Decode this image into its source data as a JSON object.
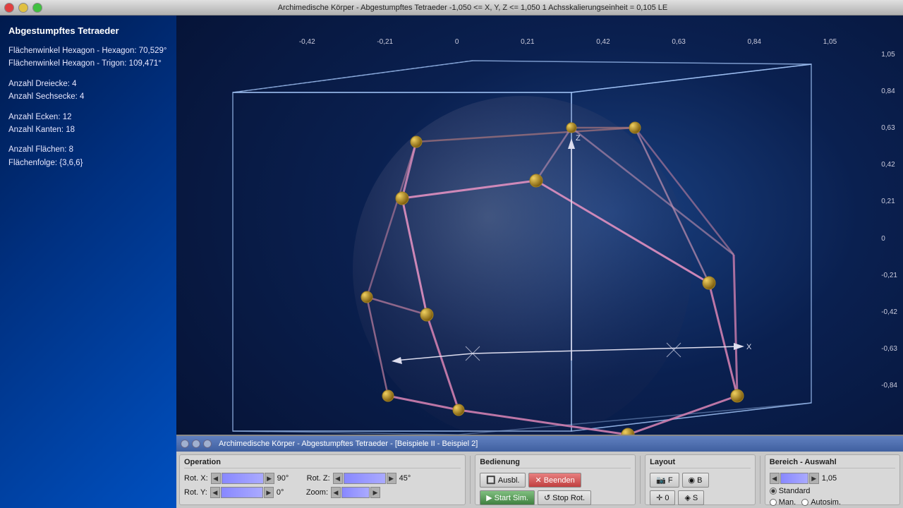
{
  "titlebar": {
    "text": "Archimedische Körper - Abgestumpftes Tetraeder  -1,050 <= X, Y, Z <= 1,050  1 Achsskalierungseinheit = 0,105 LE"
  },
  "info": {
    "title": "Abgestumpftes Tetraeder",
    "flaechen_winkel_1_label": "Flächenwinkel Hexagon - Hexagon: 70,529°",
    "flaechen_winkel_2_label": "Flächenwinkel Hexagon - Trigon: 109,471°",
    "anzahl_dreiecke_label": "Anzahl Dreiecke: 4",
    "anzahl_sechsecke_label": "Anzahl Sechsecke: 4",
    "anzahl_ecken_label": "Anzahl Ecken: 12",
    "anzahl_kanten_label": "Anzahl Kanten: 18",
    "anzahl_flaechen_label": "Anzahl Flächen: 8",
    "flaechenfolge_label": "Flächenfolge: {3,6,6}"
  },
  "subtitlebar": {
    "text": "Archimedische Körper - Abgestumpftes Tetraeder - [Beispiele II - Beispiel 2]"
  },
  "controls": {
    "operation_label": "Operation",
    "rot_x_label": "Rot. X:",
    "rot_x_value": "90°",
    "rot_z_label": "Rot. Z:",
    "rot_z_value": "45°",
    "rot_y_label": "Rot. Y:",
    "rot_y_value": "0°",
    "zoom_label": "Zoom:",
    "bedienung_label": "Bedienung",
    "ausbl_label": "Ausbl.",
    "beenden_label": "Beenden",
    "start_sim_label": "Start Sim.",
    "stop_rot_label": "Stop Rot.",
    "layout_label": "Layout",
    "icon_f": "F",
    "icon_b": "B",
    "icon_0": "0",
    "icon_s": "S",
    "bereich_label": "Bereich - Auswahl",
    "bereich_value": "1,05",
    "standard_label": "Standard",
    "man_label": "Man.",
    "autosim_label": "Autosim."
  },
  "y_axis_labels": [
    "1,05",
    "0,84",
    "0,63",
    "0,42",
    "0,21",
    "0",
    "-0,21",
    "-0,42",
    "-0,63",
    "-0,84"
  ],
  "x_axis_labels": [
    "-0,42",
    "-0,21",
    "0",
    "0,21",
    "0,42",
    "0,63",
    "0,84",
    "1,05"
  ]
}
